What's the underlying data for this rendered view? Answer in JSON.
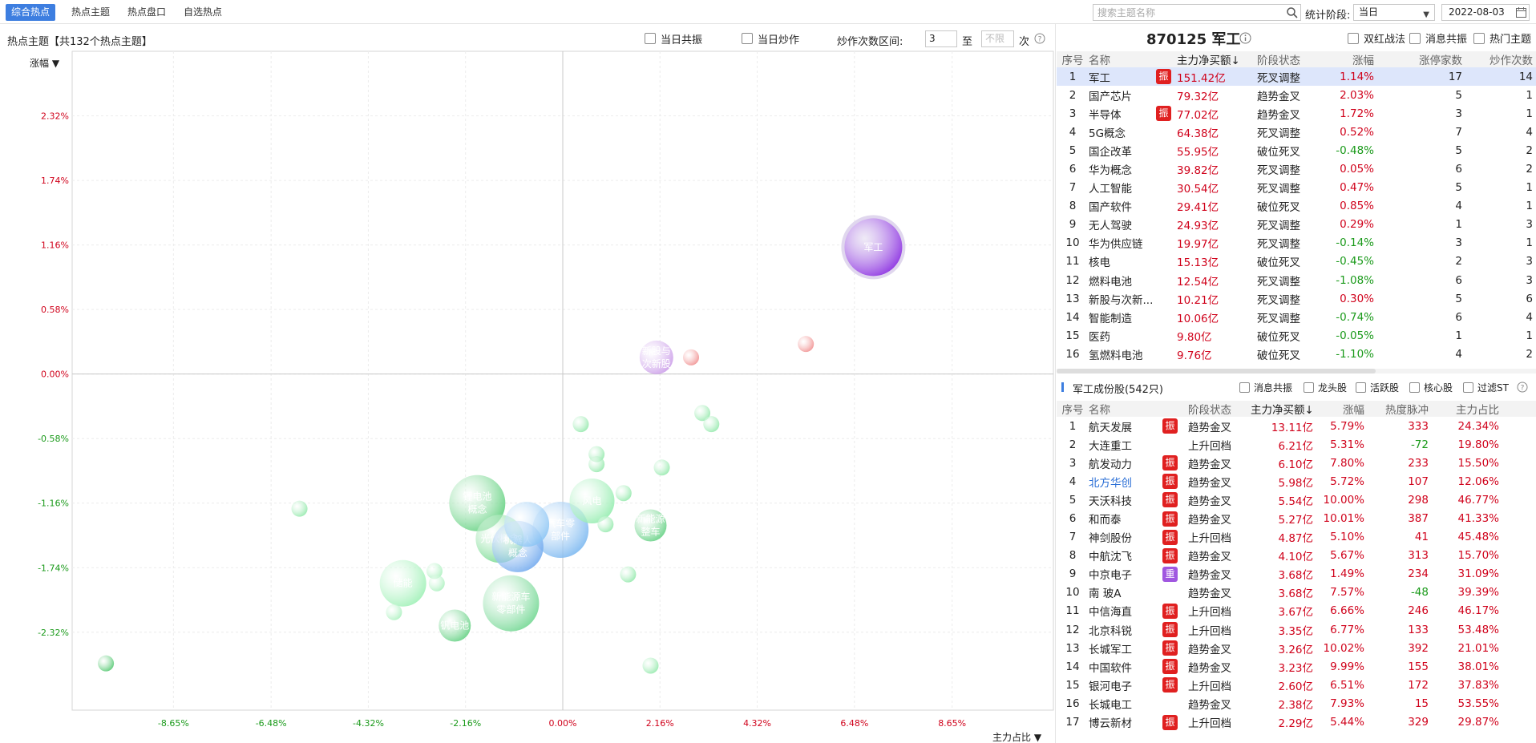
{
  "nav": {
    "tabs": [
      "综合热点",
      "热点主题",
      "热点盘口",
      "自选热点"
    ],
    "search_placeholder": "搜索主题名称",
    "period_label": "统计阶段:",
    "period_value": "当日",
    "date": "2022-08-03"
  },
  "chart_panel": {
    "title": "热点主题【共132个热点主题】",
    "filter_resonance": "当日共振",
    "filter_hype": "当日炒作",
    "range_label": "炒作次数区间:",
    "range_from": "3",
    "range_to_label": "至",
    "range_to": "不限",
    "range_unit": "次",
    "y_axis_label": "涨幅",
    "x_axis_label": "主力占比"
  },
  "chart_data": {
    "type": "scatter",
    "xlabel": "主力占比",
    "ylabel": "涨幅",
    "xlim": [
      -10.9,
      10.9
    ],
    "ylim": [
      -3.02,
      2.9
    ],
    "x_ticks": [
      "-8.65%",
      "-6.48%",
      "-4.32%",
      "-2.16%",
      "0.00%",
      "2.16%",
      "4.32%",
      "6.48%",
      "8.65%"
    ],
    "x_tick_values": [
      -8.65,
      -6.48,
      -4.32,
      -2.16,
      0,
      2.16,
      4.32,
      6.48,
      8.65
    ],
    "y_ticks": [
      "2.32%",
      "1.74%",
      "1.16%",
      "0.58%",
      "0.00%",
      "-0.58%",
      "-1.16%",
      "-1.74%",
      "-2.32%"
    ],
    "y_tick_values": [
      2.32,
      1.74,
      1.16,
      0.58,
      0,
      -0.58,
      -1.16,
      -1.74,
      -2.32
    ],
    "points": [
      {
        "label": "军工",
        "x": 6.9,
        "y": 1.14,
        "size": 36,
        "color": "#8a2be2"
      },
      {
        "label": "新股与次新股",
        "x": 2.08,
        "y": 0.15,
        "size": 21,
        "color": "#c99ae8"
      },
      {
        "label": "",
        "x": 2.85,
        "y": 0.15,
        "size": 10,
        "color": "#f08a8a"
      },
      {
        "label": "",
        "x": 5.4,
        "y": 0.27,
        "size": 10,
        "color": "#f08a8a"
      },
      {
        "label": "锂电池概念",
        "x": -1.9,
        "y": -1.16,
        "size": 35,
        "color": "#5ccf7a"
      },
      {
        "label": "光伏概念",
        "x": -1.4,
        "y": -1.48,
        "size": 30,
        "color": "#6dd888"
      },
      {
        "label": "汽车零部件",
        "x": -0.05,
        "y": -1.4,
        "size": 35,
        "color": "#78b6f0"
      },
      {
        "label": "机器人概念",
        "x": -1.0,
        "y": -1.55,
        "size": 32,
        "color": "#6fa8ee"
      },
      {
        "label": "",
        "x": -0.8,
        "y": -1.35,
        "size": 28,
        "color": "#8ac4f4"
      },
      {
        "label": "新能源车零部件",
        "x": -1.15,
        "y": -2.06,
        "size": 35,
        "color": "#6fd690"
      },
      {
        "label": "储能",
        "x": -3.55,
        "y": -1.88,
        "size": 29,
        "color": "#9cf0b4"
      },
      {
        "label": "钒电池",
        "x": -2.4,
        "y": -2.26,
        "size": 20,
        "color": "#5fcf7f"
      },
      {
        "label": "风电",
        "x": 0.65,
        "y": -1.14,
        "size": 28,
        "color": "#90ecac"
      },
      {
        "label": "新能源整车",
        "x": 1.95,
        "y": -1.36,
        "size": 20,
        "color": "#5fcf7f"
      },
      {
        "label": "",
        "x": -10.15,
        "y": -2.6,
        "size": 10,
        "color": "#4cc56a"
      },
      {
        "label": "",
        "x": -5.85,
        "y": -1.21,
        "size": 10,
        "color": "#8fe8a8"
      },
      {
        "label": "",
        "x": 0.4,
        "y": -0.45,
        "size": 10,
        "color": "#8fe8a8"
      },
      {
        "label": "",
        "x": 0.75,
        "y": -0.72,
        "size": 10,
        "color": "#8fe8a8"
      },
      {
        "label": "",
        "x": 0.75,
        "y": -0.81,
        "size": 10,
        "color": "#8fe8a8"
      },
      {
        "label": "",
        "x": 2.2,
        "y": -0.84,
        "size": 10,
        "color": "#8fe8a8"
      },
      {
        "label": "",
        "x": 3.1,
        "y": -0.35,
        "size": 10,
        "color": "#8fe8a8"
      },
      {
        "label": "",
        "x": 3.3,
        "y": -0.45,
        "size": 10,
        "color": "#8fe8a8"
      },
      {
        "label": "",
        "x": 1.35,
        "y": -1.07,
        "size": 10,
        "color": "#8fe8a8"
      },
      {
        "label": "",
        "x": 0.95,
        "y": -1.35,
        "size": 10,
        "color": "#8fe8a8"
      },
      {
        "label": "",
        "x": 1.45,
        "y": -1.8,
        "size": 10,
        "color": "#8fe8a8"
      },
      {
        "label": "",
        "x": 1.95,
        "y": -2.62,
        "size": 10,
        "color": "#8fe8a8"
      },
      {
        "label": "",
        "x": -2.85,
        "y": -1.77,
        "size": 10,
        "color": "#a8f0bc"
      },
      {
        "label": "",
        "x": -2.8,
        "y": -1.88,
        "size": 10,
        "color": "#a8f0bc"
      },
      {
        "label": "",
        "x": -3.75,
        "y": -2.14,
        "size": 10,
        "color": "#a8f0bc"
      }
    ]
  },
  "topic": {
    "title": "870125 军工",
    "filters": [
      "双红战法",
      "消息共振",
      "热门主题"
    ],
    "columns": [
      "序号",
      "名称",
      "主力净买额↓",
      "阶段状态",
      "涨幅",
      "涨停家数",
      "炒作次数"
    ],
    "rows": [
      {
        "idx": "1",
        "name": "军工",
        "badge": "振",
        "amount": "151.42亿",
        "stage": "死叉调整",
        "change": "1.14%",
        "limit_up": "17",
        "hype": "14"
      },
      {
        "idx": "2",
        "name": "国产芯片",
        "badge": "",
        "amount": "79.32亿",
        "stage": "趋势金叉",
        "change": "2.03%",
        "limit_up": "5",
        "hype": "1"
      },
      {
        "idx": "3",
        "name": "半导体",
        "badge": "振",
        "amount": "77.02亿",
        "stage": "趋势金叉",
        "change": "1.72%",
        "limit_up": "3",
        "hype": "1"
      },
      {
        "idx": "4",
        "name": "5G概念",
        "badge": "",
        "amount": "64.38亿",
        "stage": "死叉调整",
        "change": "0.52%",
        "limit_up": "7",
        "hype": "4"
      },
      {
        "idx": "5",
        "name": "国企改革",
        "badge": "",
        "amount": "55.95亿",
        "stage": "破位死叉",
        "change": "-0.48%",
        "limit_up": "5",
        "hype": "2"
      },
      {
        "idx": "6",
        "name": "华为概念",
        "badge": "",
        "amount": "39.82亿",
        "stage": "死叉调整",
        "change": "0.05%",
        "limit_up": "6",
        "hype": "2"
      },
      {
        "idx": "7",
        "name": "人工智能",
        "badge": "",
        "amount": "30.54亿",
        "stage": "死叉调整",
        "change": "0.47%",
        "limit_up": "5",
        "hype": "1"
      },
      {
        "idx": "8",
        "name": "国产软件",
        "badge": "",
        "amount": "29.41亿",
        "stage": "破位死叉",
        "change": "0.85%",
        "limit_up": "4",
        "hype": "1"
      },
      {
        "idx": "9",
        "name": "无人驾驶",
        "badge": "",
        "amount": "24.93亿",
        "stage": "死叉调整",
        "change": "0.29%",
        "limit_up": "1",
        "hype": "3"
      },
      {
        "idx": "10",
        "name": "华为供应链",
        "badge": "",
        "amount": "19.97亿",
        "stage": "死叉调整",
        "change": "-0.14%",
        "limit_up": "3",
        "hype": "1"
      },
      {
        "idx": "11",
        "name": "核电",
        "badge": "",
        "amount": "15.13亿",
        "stage": "破位死叉",
        "change": "-0.45%",
        "limit_up": "2",
        "hype": "3"
      },
      {
        "idx": "12",
        "name": "燃料电池",
        "badge": "",
        "amount": "12.54亿",
        "stage": "死叉调整",
        "change": "-1.08%",
        "limit_up": "6",
        "hype": "3"
      },
      {
        "idx": "13",
        "name": "新股与次新...",
        "badge": "",
        "amount": "10.21亿",
        "stage": "死叉调整",
        "change": "0.30%",
        "limit_up": "5",
        "hype": "6"
      },
      {
        "idx": "14",
        "name": "智能制造",
        "badge": "",
        "amount": "10.06亿",
        "stage": "死叉调整",
        "change": "-0.74%",
        "limit_up": "6",
        "hype": "4"
      },
      {
        "idx": "15",
        "name": "医药",
        "badge": "",
        "amount": "9.80亿",
        "stage": "破位死叉",
        "change": "-0.05%",
        "limit_up": "1",
        "hype": "1"
      },
      {
        "idx": "16",
        "name": "氢燃料电池",
        "badge": "",
        "amount": "9.76亿",
        "stage": "破位死叉",
        "change": "-1.10%",
        "limit_up": "4",
        "hype": "2"
      }
    ]
  },
  "components": {
    "title": "军工成份股(542只)",
    "filters": [
      "消息共振",
      "龙头股",
      "活跃股",
      "核心股",
      "过滤ST"
    ],
    "columns": [
      "序号",
      "名称",
      "阶段状态",
      "主力净买额↓",
      "涨幅",
      "热度脉冲",
      "主力占比"
    ],
    "rows": [
      {
        "idx": "1",
        "name": "航天发展",
        "badge": "振",
        "stage": "趋势金叉",
        "amount": "13.11亿",
        "change": "5.79%",
        "heat": "333",
        "ratio": "24.34%"
      },
      {
        "idx": "2",
        "name": "大连重工",
        "badge": "",
        "stage": "上升回档",
        "amount": "6.21亿",
        "change": "5.31%",
        "heat": "-72",
        "ratio": "19.80%"
      },
      {
        "idx": "3",
        "name": "航发动力",
        "badge": "振",
        "stage": "趋势金叉",
        "amount": "6.10亿",
        "change": "7.80%",
        "heat": "233",
        "ratio": "15.50%"
      },
      {
        "idx": "4",
        "name": "北方华创",
        "badge": "振",
        "stage": "趋势金叉",
        "amount": "5.98亿",
        "change": "5.72%",
        "heat": "107",
        "ratio": "12.06%"
      },
      {
        "idx": "5",
        "name": "天沃科技",
        "badge": "振",
        "stage": "趋势金叉",
        "amount": "5.54亿",
        "change": "10.00%",
        "heat": "298",
        "ratio": "46.77%"
      },
      {
        "idx": "6",
        "name": "和而泰",
        "badge": "振",
        "stage": "趋势金叉",
        "amount": "5.27亿",
        "change": "10.01%",
        "heat": "387",
        "ratio": "41.33%"
      },
      {
        "idx": "7",
        "name": "神剑股份",
        "badge": "振",
        "stage": "上升回档",
        "amount": "4.87亿",
        "change": "5.10%",
        "heat": "41",
        "ratio": "45.48%"
      },
      {
        "idx": "8",
        "name": "中航沈飞",
        "badge": "振",
        "stage": "趋势金叉",
        "amount": "4.10亿",
        "change": "5.67%",
        "heat": "313",
        "ratio": "15.70%"
      },
      {
        "idx": "9",
        "name": "中京电子",
        "badge": "重",
        "stage": "趋势金叉",
        "amount": "3.68亿",
        "change": "1.49%",
        "heat": "234",
        "ratio": "31.09%"
      },
      {
        "idx": "10",
        "name": "南 玻A",
        "badge": "",
        "stage": "趋势金叉",
        "amount": "3.68亿",
        "change": "7.57%",
        "heat": "-48",
        "ratio": "39.39%"
      },
      {
        "idx": "11",
        "name": "中信海直",
        "badge": "振",
        "stage": "上升回档",
        "amount": "3.67亿",
        "change": "6.66%",
        "heat": "246",
        "ratio": "46.17%"
      },
      {
        "idx": "12",
        "name": "北京科锐",
        "badge": "振",
        "stage": "上升回档",
        "amount": "3.35亿",
        "change": "6.77%",
        "heat": "133",
        "ratio": "53.48%"
      },
      {
        "idx": "13",
        "name": "长城军工",
        "badge": "振",
        "stage": "趋势金叉",
        "amount": "3.26亿",
        "change": "10.02%",
        "heat": "392",
        "ratio": "21.01%"
      },
      {
        "idx": "14",
        "name": "中国软件",
        "badge": "振",
        "stage": "趋势金叉",
        "amount": "3.23亿",
        "change": "9.99%",
        "heat": "155",
        "ratio": "38.01%"
      },
      {
        "idx": "15",
        "name": "银河电子",
        "badge": "振",
        "stage": "上升回档",
        "amount": "2.60亿",
        "change": "6.51%",
        "heat": "172",
        "ratio": "37.83%"
      },
      {
        "idx": "16",
        "name": "长城电工",
        "badge": "",
        "stage": "趋势金叉",
        "amount": "2.38亿",
        "change": "7.93%",
        "heat": "15",
        "ratio": "53.55%"
      },
      {
        "idx": "17",
        "name": "博云新材",
        "badge": "振",
        "stage": "上升回档",
        "amount": "2.29亿",
        "change": "5.44%",
        "heat": "329",
        "ratio": "29.87%"
      }
    ]
  }
}
